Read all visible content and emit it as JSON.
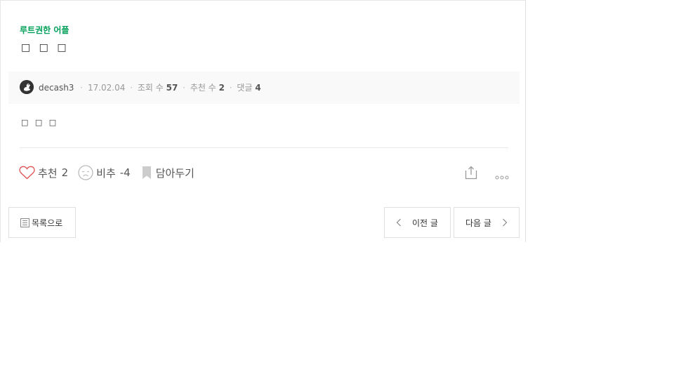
{
  "post": {
    "category": "루트권한 어플",
    "title": "□ □ □",
    "body": "□ □ □"
  },
  "meta": {
    "author": "decash3",
    "date": "17.02.04",
    "views_label": "조회 수",
    "views": "57",
    "recommend_label": "추천 수",
    "recommend": "2",
    "comments_label": "댓글",
    "comments": "4"
  },
  "actions": {
    "like_label": "추천",
    "like_count": "2",
    "dislike_label": "비추",
    "dislike_count": "-4",
    "bookmark_label": "담아두기"
  },
  "nav": {
    "list_label": "목록으로",
    "prev_label": "이전 글",
    "next_label": "다음 글"
  },
  "colors": {
    "accent": "#00a05a",
    "like": "#e05050",
    "icon_gray": "#bbbbbb"
  },
  "icons": [
    "avatar-duck",
    "heart-icon",
    "sad-face-icon",
    "bookmark-icon",
    "share-icon",
    "more-icon",
    "list-icon",
    "chevron-left-icon",
    "chevron-right-icon"
  ]
}
